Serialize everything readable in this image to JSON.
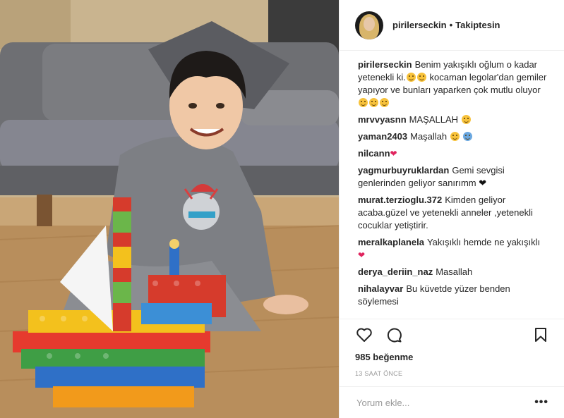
{
  "post": {
    "username": "pirilerseckin",
    "follow_status": "Takiptesin",
    "caption_parts": [
      "Benim yakışıklı oğlum o kadar yetenekli ki.",
      " kocaman legolar'dan gemiler yapıyor ve bunları yaparken çok mutlu oluyor"
    ],
    "comments": [
      {
        "user": "mrvvyasnn",
        "text": "MAŞALLAH"
      },
      {
        "user": "yaman2403",
        "text": "Maşallah"
      },
      {
        "user": "nilcann",
        "text": ""
      },
      {
        "user": "yagmurbuyruklardan",
        "text": "Gemi sevgisi genlerinden geliyor sanırımm"
      },
      {
        "user": "murat.terzioglu.372",
        "text": "Kimden geliyor acaba.güzel ve yetenekli anneler ,yetenekli cocuklar yetiştirir."
      },
      {
        "user": "meralkaplanela",
        "text": "Yakışıklı hemde ne yakışıklı"
      },
      {
        "user": "derya_deriin_naz",
        "text": "Masallah"
      },
      {
        "user": "nihalayvar",
        "text": "Bu küvetde yüzer benden söylemesi"
      }
    ],
    "likes": "985 beğenme",
    "time_ago": "13 SAAT ÖNCE",
    "comment_placeholder": "Yorum ekle...",
    "more_label": "•••"
  },
  "icons": {
    "like": "heart-icon",
    "comment": "comment-icon",
    "save": "bookmark-icon"
  },
  "colors": {
    "border": "#efefef",
    "text": "#262626",
    "muted": "#999999",
    "heart": "#e0245e"
  }
}
